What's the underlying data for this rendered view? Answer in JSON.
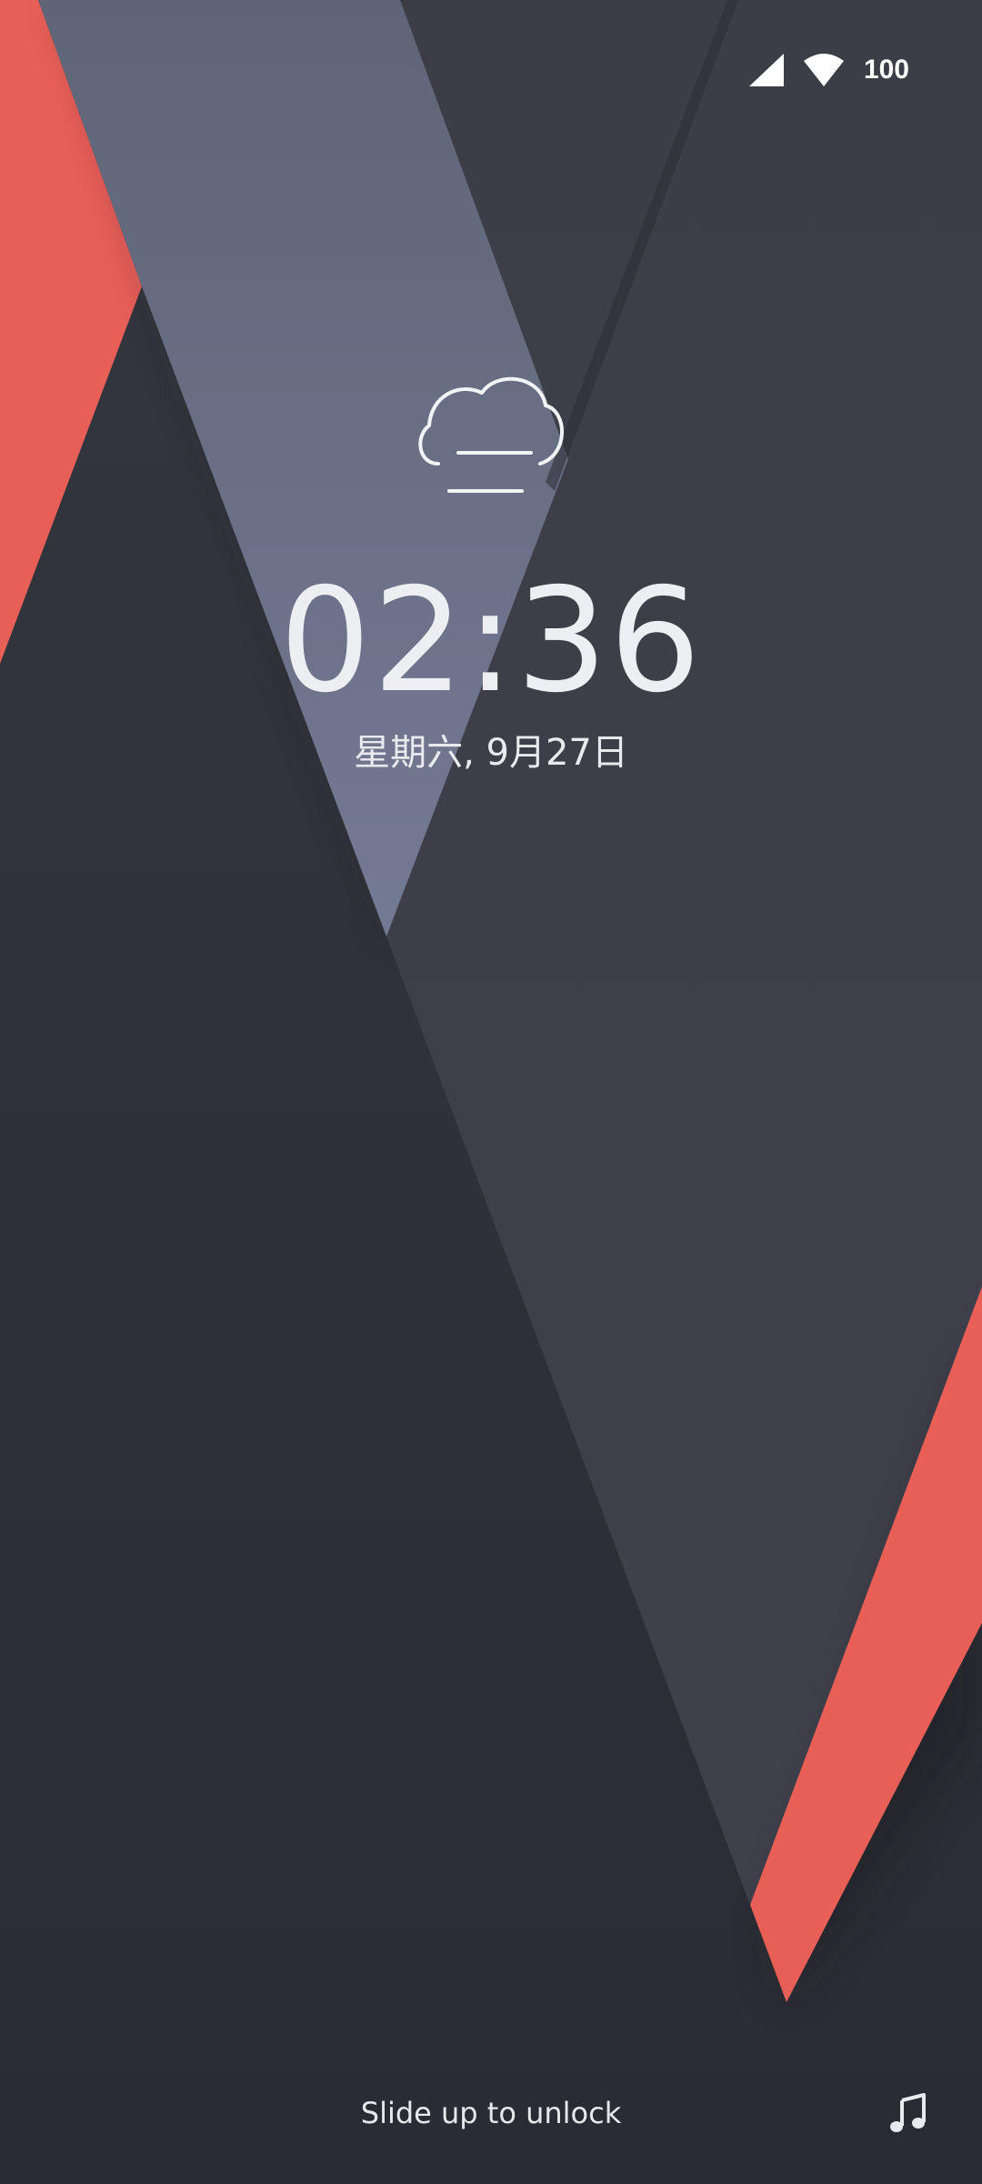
{
  "status_bar": {
    "signal_icon": "cellular-signal-icon",
    "wifi_icon": "wifi-icon",
    "battery_level": "100"
  },
  "lock_screen": {
    "weather_icon": "cloudy-fog-icon",
    "time": "02:36",
    "date": "星期六, 9月27日",
    "unlock_hint": "Slide up to unlock",
    "music_icon": "music-note-icon"
  },
  "colors": {
    "accent_red": "#e85f58",
    "panel_slate": "#6a7187",
    "dark_panel": "#3d3e48",
    "background": "#2f3139",
    "text": "#eceef2"
  }
}
